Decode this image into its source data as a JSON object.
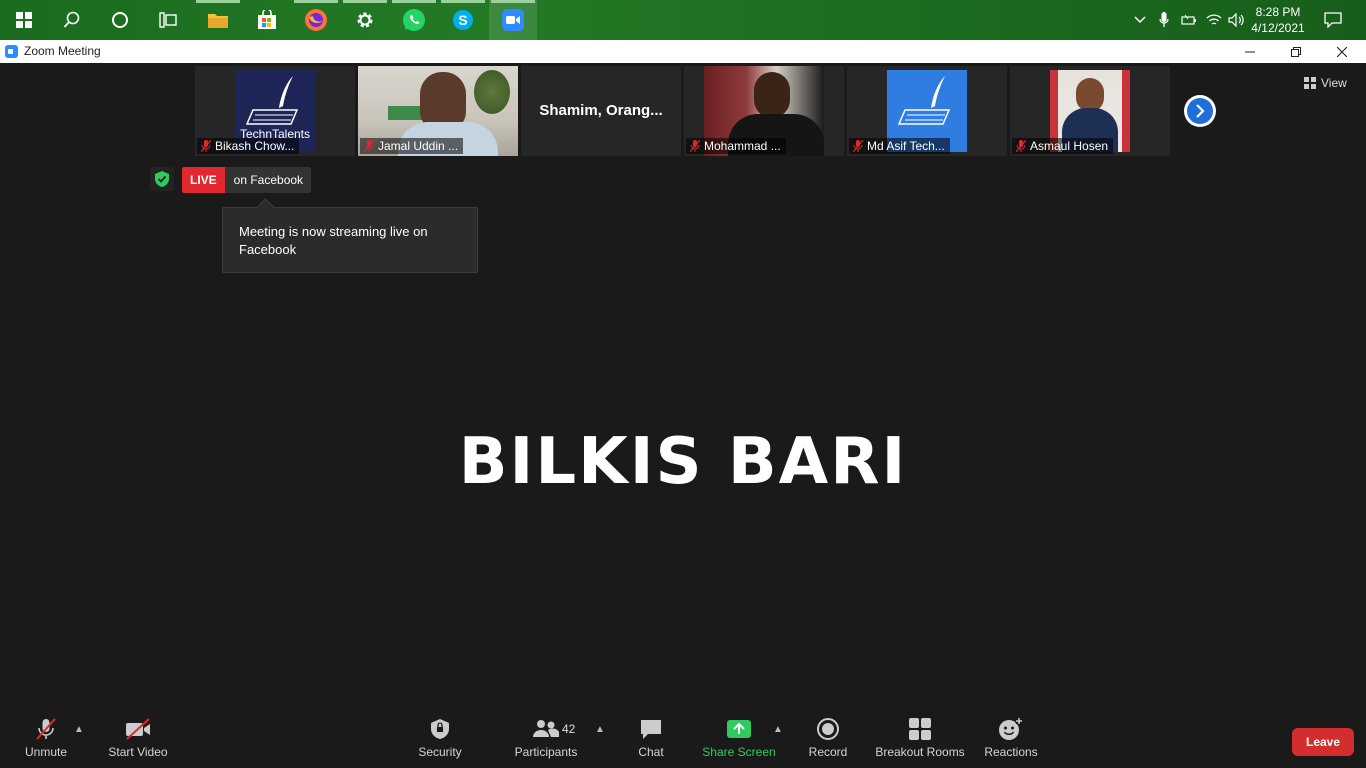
{
  "taskbar": {
    "clock_time": "8:28 PM",
    "clock_date": "4/12/2021"
  },
  "window": {
    "title": "Zoom Meeting"
  },
  "gallery": {
    "participants": [
      {
        "name": "Bikash Chow...",
        "muted": true,
        "tile": "logo"
      },
      {
        "name": "Jamal Uddin ...",
        "muted": true,
        "tile": "video"
      },
      {
        "name": "Shamim,  Orang...",
        "muted": false,
        "tile": "name-only"
      },
      {
        "name": "Mohammad ...",
        "muted": true,
        "tile": "video"
      },
      {
        "name": "Md Asif Tech...",
        "muted": true,
        "tile": "logo"
      },
      {
        "name": "Asmaul Hosen",
        "muted": true,
        "tile": "photo"
      }
    ],
    "logo_text": "TechnTalents",
    "next_page_icon": "chevron-right-icon"
  },
  "view_label": "View",
  "live": {
    "badge": "LIVE",
    "platform": "on Facebook",
    "tooltip": "Meeting is now streaming live on Facebook"
  },
  "active_speaker": "BILKIS BARI",
  "toolbar": {
    "unmute": "Unmute",
    "start_video": "Start Video",
    "security": "Security",
    "participants": "Participants",
    "participants_count": "42",
    "chat": "Chat",
    "share_screen": "Share Screen",
    "record": "Record",
    "breakout_rooms": "Breakout Rooms",
    "reactions": "Reactions",
    "leave": "Leave"
  },
  "colors": {
    "live_red": "#e0282e",
    "share_green": "#2ecc5c",
    "leave_red": "#d32d2d",
    "zoom_blue": "#2d8cff"
  }
}
